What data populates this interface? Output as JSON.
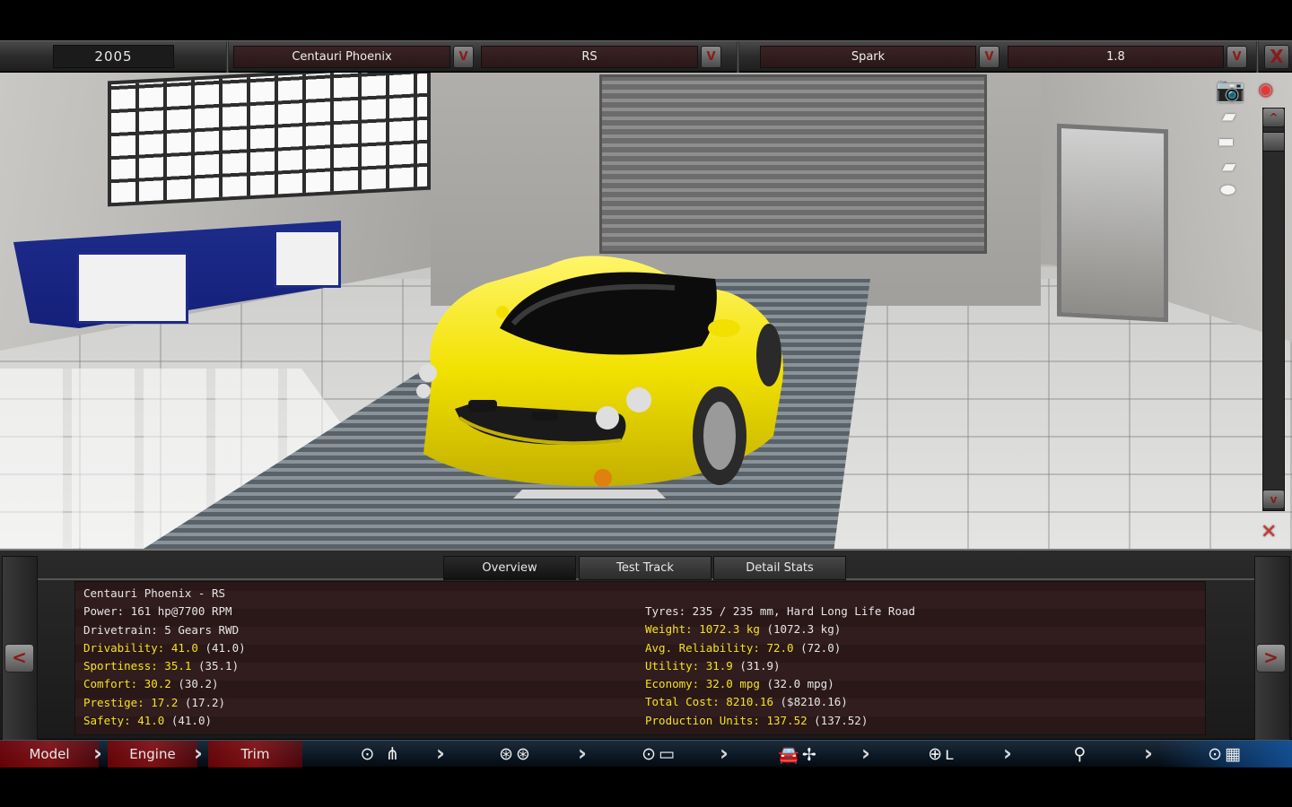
{
  "header": {
    "year": "2005",
    "model": "Centauri Phoenix",
    "trim": "RS",
    "engine": "Spark",
    "displacement": "1.8",
    "dropdown_arrow": "V",
    "close_label": "X"
  },
  "viewport": {
    "camera_icon": "camera-icon",
    "record_icon": "eye-icon",
    "view_icons": [
      "car-front-icon",
      "car-side-icon",
      "car-rear-icon",
      "car-top-icon"
    ],
    "scroll_up": "^",
    "scroll_down": "v"
  },
  "tabs": [
    {
      "label": "Overview",
      "active": true
    },
    {
      "label": "Test Track",
      "active": false
    },
    {
      "label": "Detail Stats",
      "active": false
    }
  ],
  "nav": {
    "prev": "<",
    "next": ">"
  },
  "stats": {
    "title": "Centauri Phoenix - RS",
    "left": [
      {
        "label": "Power: 161 hp@7700 RPM",
        "value": "",
        "highlight": false
      },
      {
        "label": "Drivetrain: 5 Gears RWD",
        "value": "",
        "highlight": false
      },
      {
        "label": "Drivability: 41.0",
        "value": "(41.0)",
        "highlight": true
      },
      {
        "label": "Sportiness: 35.1",
        "value": "(35.1)",
        "highlight": true
      },
      {
        "label": "Comfort: 30.2",
        "value": "(30.2)",
        "highlight": true
      },
      {
        "label": "Prestige: 17.2",
        "value": "(17.2)",
        "highlight": true
      },
      {
        "label": "Safety: 41.0",
        "value": "(41.0)",
        "highlight": true
      }
    ],
    "right": [
      {
        "label": "Tyres: 235 / 235 mm, Hard Long Life Road",
        "value": "",
        "highlight": false
      },
      {
        "label": "Weight: 1072.3 kg",
        "value": "(1072.3 kg)",
        "highlight": true
      },
      {
        "label": "Avg. Reliability: 72.0",
        "value": "(72.0)",
        "highlight": true
      },
      {
        "label": "Utility: 31.9",
        "value": "(31.9)",
        "highlight": true
      },
      {
        "label": "Economy: 32.0 mpg",
        "value": "(32.0 mpg)",
        "highlight": true
      },
      {
        "label": "Total Cost: 8210.16",
        "value": "($8210.16)",
        "highlight": true
      },
      {
        "label": "Production Units: 137.52",
        "value": "(137.52)",
        "highlight": true
      }
    ]
  },
  "navbar": {
    "model": "Model",
    "engine": "Engine",
    "trim": "Trim",
    "icons": [
      "gearbox-icon",
      "wheels-icon",
      "chassis-icon",
      "body-aero-icon",
      "interior-icon",
      "suspension-icon",
      "finish-icon"
    ]
  },
  "colors": {
    "highlight": "#f2e31e",
    "accent_red": "#8b1a1a",
    "stats_bg": "#2a1718"
  }
}
